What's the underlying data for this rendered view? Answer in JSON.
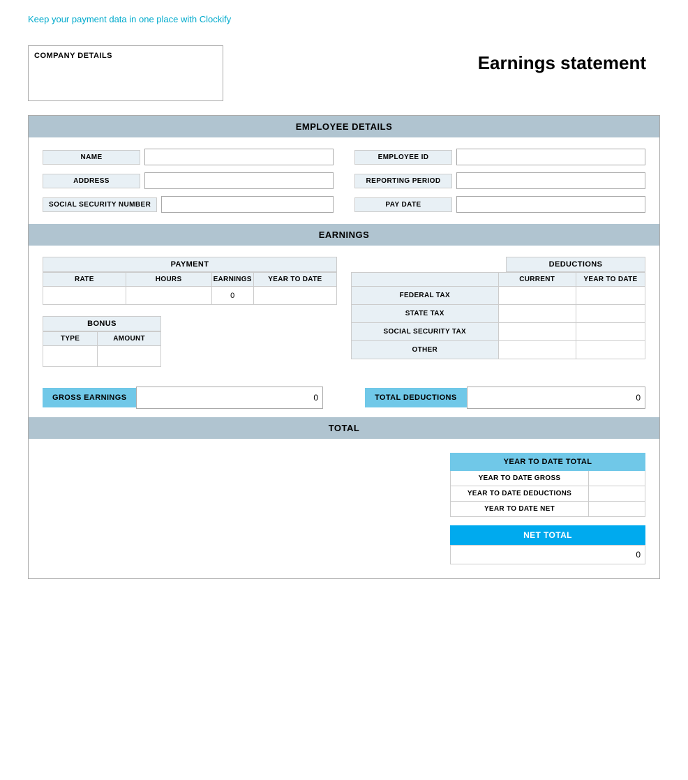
{
  "topLink": {
    "text": "Keep your payment data in one place with Clockify",
    "href": "#"
  },
  "header": {
    "companyLabel": "COMPANY DETAILS",
    "title": "Earnings statement"
  },
  "employeeSection": {
    "label": "EMPLOYEE DETAILS",
    "fields": {
      "left": [
        {
          "label": "NAME",
          "value": ""
        },
        {
          "label": "ADDRESS",
          "value": ""
        },
        {
          "label": "SOCIAL SECURITY NUMBER",
          "value": ""
        }
      ],
      "right": [
        {
          "label": "EMPLOYEE ID",
          "value": ""
        },
        {
          "label": "REPORTING PERIOD",
          "value": ""
        },
        {
          "label": "PAY DATE",
          "value": ""
        }
      ]
    }
  },
  "earningsSection": {
    "label": "EARNINGS",
    "payment": {
      "sectionLabel": "PAYMENT",
      "columns": [
        "RATE",
        "HOURS",
        "EARNINGS",
        "YEAR TO DATE"
      ],
      "rows": [
        {
          "rate": "",
          "hours": "",
          "earnings": "0",
          "ytd": ""
        }
      ]
    },
    "bonus": {
      "sectionLabel": "BONUS",
      "columns": [
        "TYPE",
        "AMOUNT"
      ],
      "rows": [
        {
          "type": "",
          "amount": ""
        }
      ]
    },
    "deductions": {
      "sectionLabel": "DEDUCTIONS",
      "columns": [
        "CURRENT",
        "YEAR TO DATE"
      ],
      "rows": [
        {
          "label": "FEDERAL TAX",
          "current": "",
          "ytd": ""
        },
        {
          "label": "STATE TAX",
          "current": "",
          "ytd": ""
        },
        {
          "label": "SOCIAL SECURITY TAX",
          "current": "",
          "ytd": ""
        },
        {
          "label": "OTHER",
          "current": "",
          "ytd": ""
        }
      ]
    },
    "totals": {
      "grossLabel": "GROSS EARNINGS",
      "grossValue": "0",
      "deductionsLabel": "TOTAL DEDUCTIONS",
      "deductionsValue": "0"
    }
  },
  "totalSection": {
    "label": "TOTAL",
    "ytdTable": {
      "header": "YEAR TO DATE TOTAL",
      "rows": [
        {
          "label": "YEAR TO DATE GROSS",
          "value": ""
        },
        {
          "label": "YEAR TO DATE DEDUCTIONS",
          "value": ""
        },
        {
          "label": "YEAR TO DATE NET",
          "value": ""
        }
      ]
    },
    "netTotal": {
      "label": "NET TOTAL",
      "value": "0"
    }
  }
}
